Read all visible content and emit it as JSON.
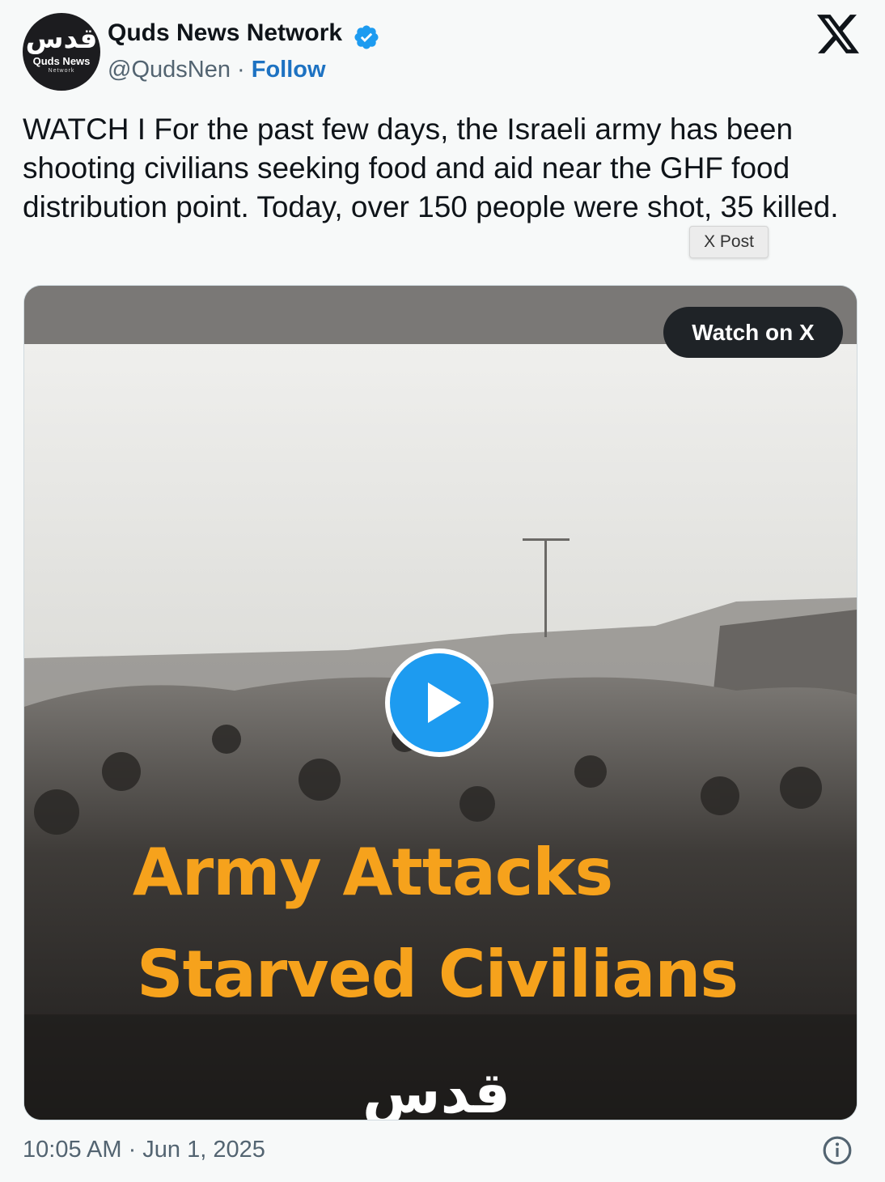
{
  "author": {
    "avatar_text": "قدس",
    "avatar_line1": "Quds News",
    "avatar_line2": "Network",
    "display_name": "Quds News Network",
    "handle": "@QudsNen",
    "separator": "·",
    "follow_label": "Follow",
    "verified_color": "#1d9bf0"
  },
  "tweet": {
    "text": "WATCH I For the past few days, the Israeli army has been shooting civilians seeking food and aid near the GHF food distribution point. Today, over 150 people were shot, 35 killed.",
    "tooltip": "X Post"
  },
  "media": {
    "watch_label": "Watch on X",
    "caption_line1": "Army Attacks",
    "caption_line2": "Starved Civilians",
    "watermark": "قدس",
    "caption_color": "#f6a21c",
    "play_color": "#1d9bf0"
  },
  "footer": {
    "timestamp": "10:05 AM · Jun 1, 2025"
  },
  "icons": [
    "x-logo-icon",
    "verified-badge-icon",
    "play-icon",
    "info-icon"
  ]
}
